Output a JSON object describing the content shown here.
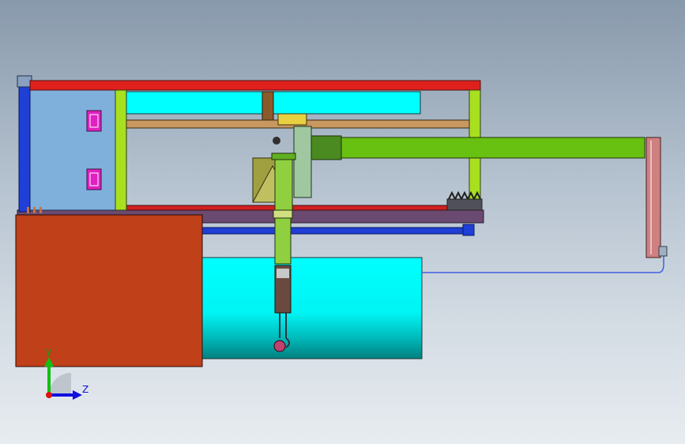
{
  "viewport": {
    "background_top": "#8899ab",
    "background_bottom": "#e7ecf0"
  },
  "triad": {
    "y_label": "Y",
    "z_label": "Z",
    "y_color": "#10c010",
    "z_color": "#1010e0",
    "origin_color": "#e01010"
  },
  "colors": {
    "frame_red": "#e0201c",
    "frame_blue": "#1f3fd6",
    "panel_blue": "#7fb0dc",
    "lime": "#a8e020",
    "cyan": "#00ffff",
    "tan": "#c89860",
    "green_arm": "#68c010",
    "box_orange": "#c0401a",
    "magenta": "#e020c0",
    "purple_base": "#6a4a70",
    "rod_pink": "#d08080"
  }
}
